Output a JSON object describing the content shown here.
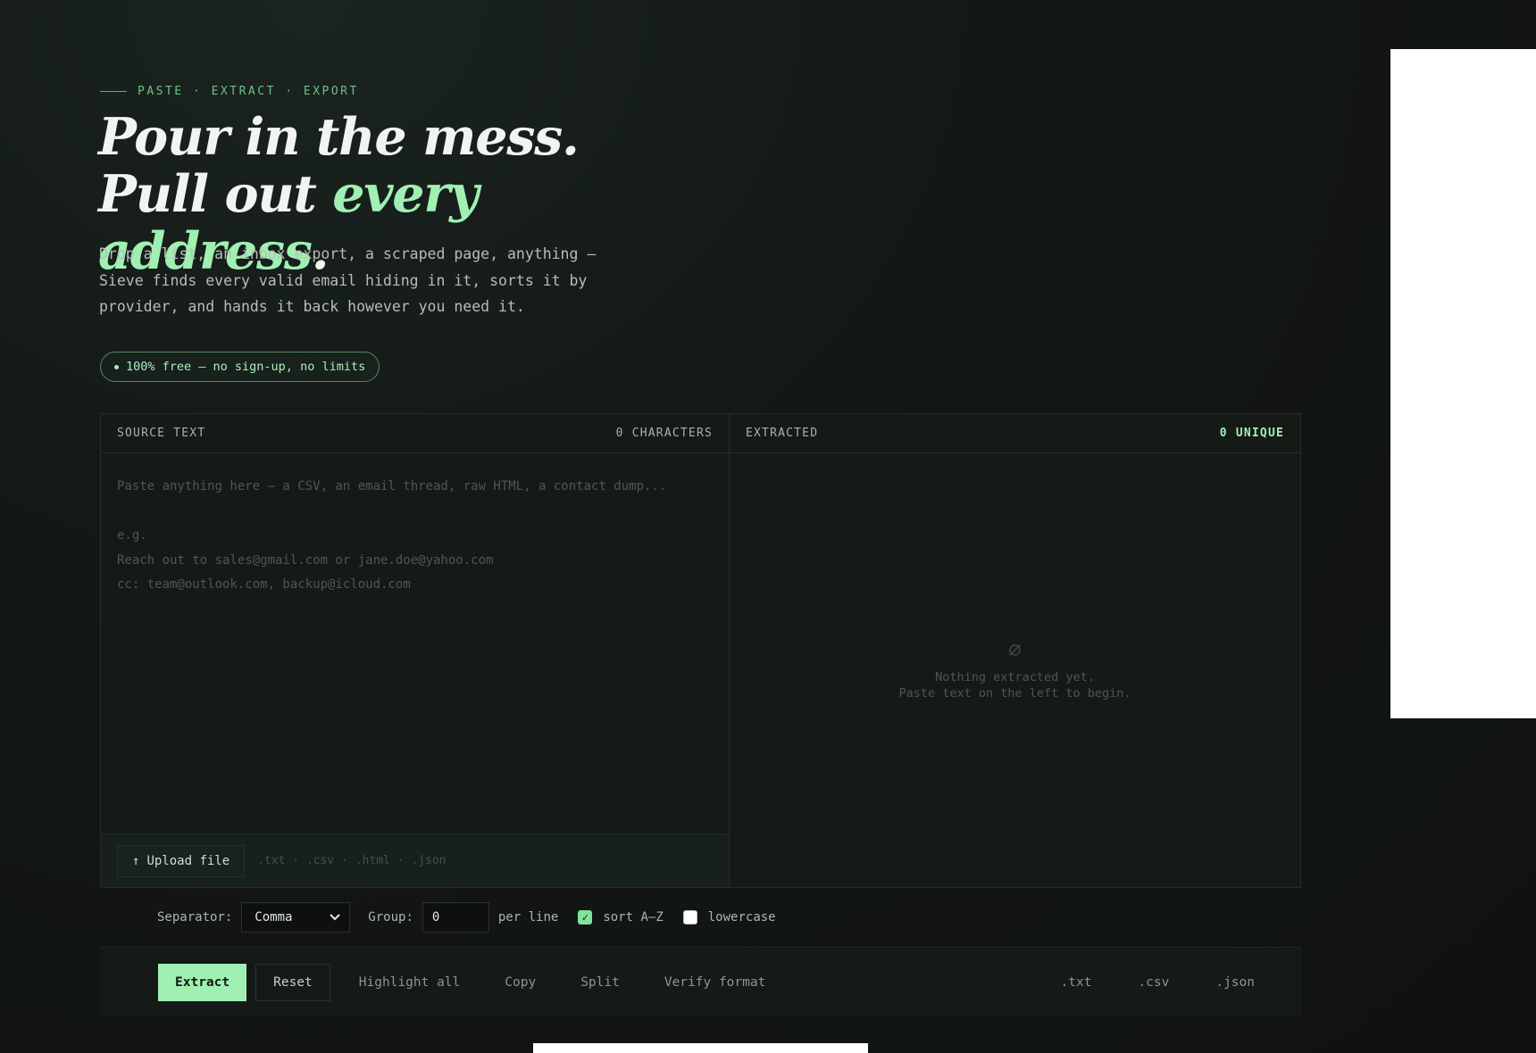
{
  "hero": {
    "eyebrow": "PASTE · EXTRACT · EXPORT",
    "headline_part1": "Pour in the mess. Pull out ",
    "headline_accent": "every address",
    "headline_end": ".",
    "intro": "Drop a list, an inbox export, a scraped page, anything — Sieve finds every valid email hiding in it, sorts it by provider, and hands it back however you need it.",
    "badge": "100% free — no sign-up, no limits"
  },
  "source": {
    "label": "SOURCE TEXT",
    "count": "0 CHARACTERS",
    "placeholder": "Paste anything here — a CSV, an email thread, raw HTML, a contact dump...\n\ne.g.\nReach out to sales@gmail.com or jane.doe@yahoo.com\ncc: team@outlook.com, backup@icloud.com",
    "upload_label": "Upload file",
    "formats": ".txt · .csv · .html · .json"
  },
  "extracted": {
    "label": "EXTRACTED",
    "count": "0 UNIQUE",
    "empty_symbol": "∅",
    "empty_line1": "Nothing extracted yet.",
    "empty_line2": "Paste text on the left to begin."
  },
  "options": {
    "separator_label": "Separator:",
    "separator_value": "Comma",
    "group_label": "Group:",
    "group_value": "0",
    "per_line": "per line",
    "sort_label": "sort A–Z",
    "sort_checked": true,
    "lowercase_label": "lowercase",
    "lowercase_checked": false
  },
  "actions": {
    "extract": "Extract",
    "reset": "Reset",
    "highlight": "Highlight all",
    "copy": "Copy",
    "split": "Split",
    "verify": "Verify format",
    "txt": ".txt",
    "csv": ".csv",
    "json": ".json"
  },
  "colors": {
    "accent": "#9ff0b2",
    "background": "#131715"
  }
}
